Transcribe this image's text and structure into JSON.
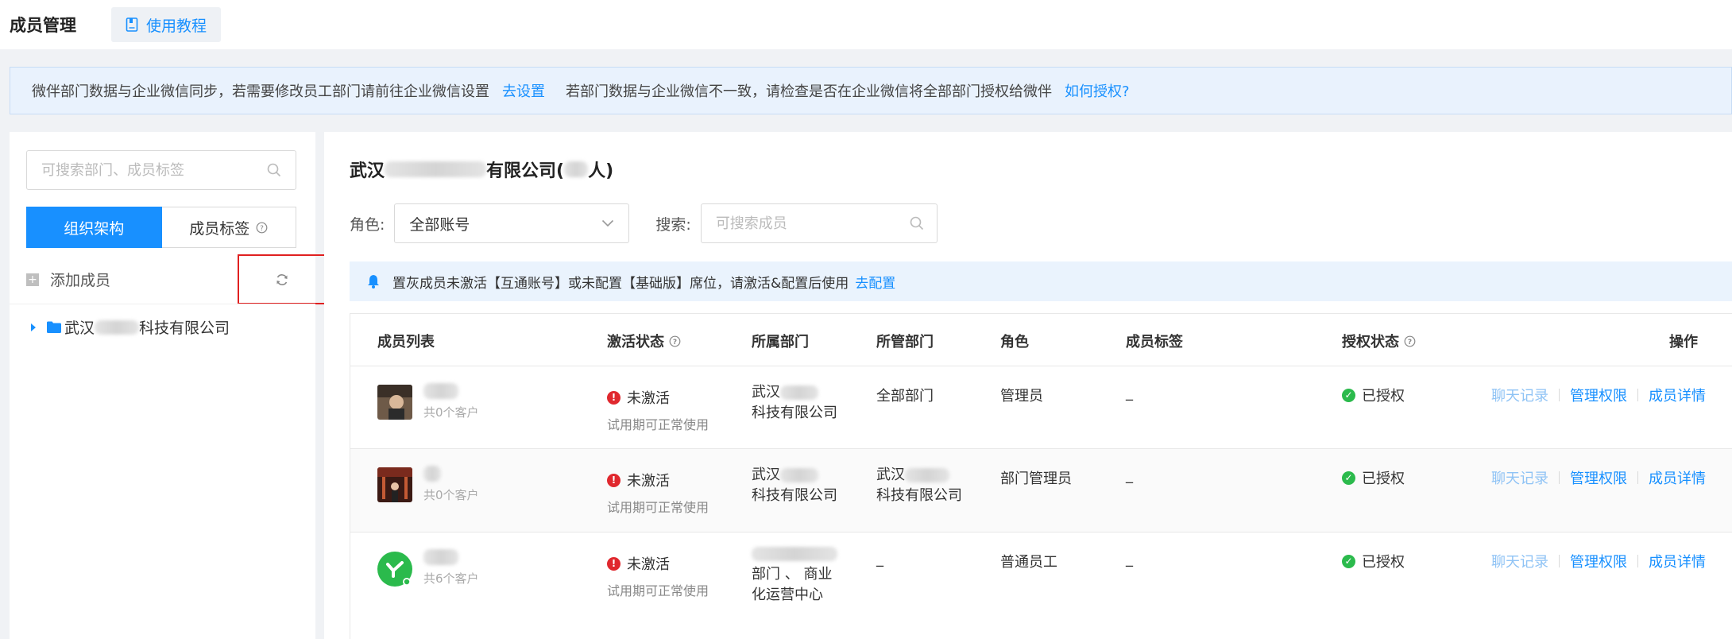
{
  "header": {
    "title": "成员管理",
    "tutorial_label": "使用教程"
  },
  "notice": {
    "text1": "微伴部门数据与企业微信同步，若需要修改员工部门请前往企业微信设置",
    "link1": "去设置",
    "text2": "若部门数据与企业微信不一致，请检查是否在企业微信将全部部门授权给微伴",
    "link2": "如何授权?"
  },
  "sidebar": {
    "search_placeholder": "可搜索部门、成员标签",
    "tabs": [
      {
        "label": "组织架构"
      },
      {
        "label": "成员标签"
      }
    ],
    "add_member_label": "添加成员",
    "tree": {
      "prefix": "武汉",
      "suffix": "科技有限公司"
    }
  },
  "main": {
    "company": {
      "prefix": "武汉",
      "middle": "有限公司(",
      "suffix": "人)"
    },
    "filter": {
      "role_label": "角色:",
      "role_value": "全部账号",
      "search_label": "搜索:",
      "search_placeholder": "可搜索成员"
    },
    "hint": {
      "text": "置灰成员未激活【互通账号】或未配置【基础版】席位，请激活&配置后使用",
      "link": "去配置"
    },
    "columns": {
      "member": "成员列表",
      "activation": "激活状态",
      "department": "所属部门",
      "managed": "所管部门",
      "role": "角色",
      "tags": "成员标签",
      "auth": "授权状态",
      "ops": "操作"
    },
    "rows": [
      {
        "customers": "共0个客户",
        "status": "未激活",
        "status_sub": "试用期可正常使用",
        "dept_line1": "武汉",
        "dept_line2": "科技有限公司",
        "dept_line3": "",
        "managed_line1": "全部部门",
        "managed_line2": "",
        "role": "管理员",
        "tags": "_",
        "auth": "已授权",
        "op_chat": "聊天记录",
        "op_perm": "管理权限",
        "op_detail": "成员详情"
      },
      {
        "customers": "共0个客户",
        "status": "未激活",
        "status_sub": "试用期可正常使用",
        "dept_line1": "武汉",
        "dept_line2": "科技有限公司",
        "dept_line3": "",
        "managed_line1": "武汉",
        "managed_line2": "科技有限公司",
        "role": "部门管理员",
        "tags": "_",
        "auth": "已授权",
        "op_chat": "聊天记录",
        "op_perm": "管理权限",
        "op_detail": "成员详情"
      },
      {
        "customers": "共6个客户",
        "status": "未激活",
        "status_sub": "试用期可正常使用",
        "dept_line1": "",
        "dept_line2": "部门 、 商业",
        "dept_line3": "化运营中心",
        "managed_line1": "_",
        "managed_line2": "",
        "role": "普通员工",
        "tags": "_",
        "auth": "已授权",
        "op_chat": "聊天记录",
        "op_perm": "管理权限",
        "op_detail": "成员详情"
      }
    ]
  },
  "colors": {
    "primary": "#1890ff",
    "danger": "#e0282e",
    "success": "#2bba4c",
    "highlight_border": "#e02020"
  }
}
